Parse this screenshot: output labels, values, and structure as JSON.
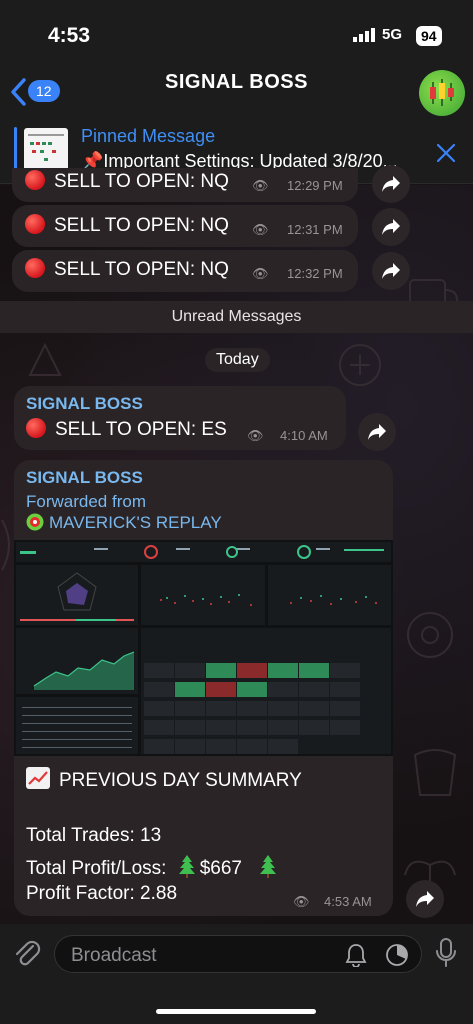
{
  "status": {
    "time": "4:53",
    "network": "5G",
    "battery": "94"
  },
  "header": {
    "back_count": "12",
    "title": "SIGNAL BOSS"
  },
  "pinned": {
    "title": "Pinned Message",
    "text": "📌Important Settings: Updated 3/8/20..."
  },
  "messages_top": [
    {
      "text": "SELL TO OPEN: NQ",
      "time": "12:29 PM"
    },
    {
      "text": "SELL TO OPEN: NQ",
      "time": "12:31 PM"
    },
    {
      "text": "SELL TO OPEN: NQ",
      "time": "12:32 PM"
    }
  ],
  "unread_label": "Unread Messages",
  "date_label": "Today",
  "message_es": {
    "sender": "SIGNAL BOSS",
    "text": "SELL TO OPEN: ES",
    "time": "4:10 AM"
  },
  "message_summary": {
    "sender": "SIGNAL BOSS",
    "forwarded_label": "Forwarded from",
    "forwarded_from": "MAVERICK'S REPLAY",
    "title": "PREVIOUS DAY SUMMARY",
    "total_trades": "Total Trades: 13",
    "profit_loss_label": "Total Profit/Loss:",
    "profit_loss_value": "$667",
    "profit_factor": "Profit Factor: 2.88",
    "time": "4:53 AM"
  },
  "input": {
    "placeholder": "Broadcast"
  },
  "colors": {
    "accent": "#3a82f7",
    "sender": "#79b8ee",
    "bubble": "#2a2426",
    "red": "#d7161d",
    "green": "#2e8b57"
  }
}
